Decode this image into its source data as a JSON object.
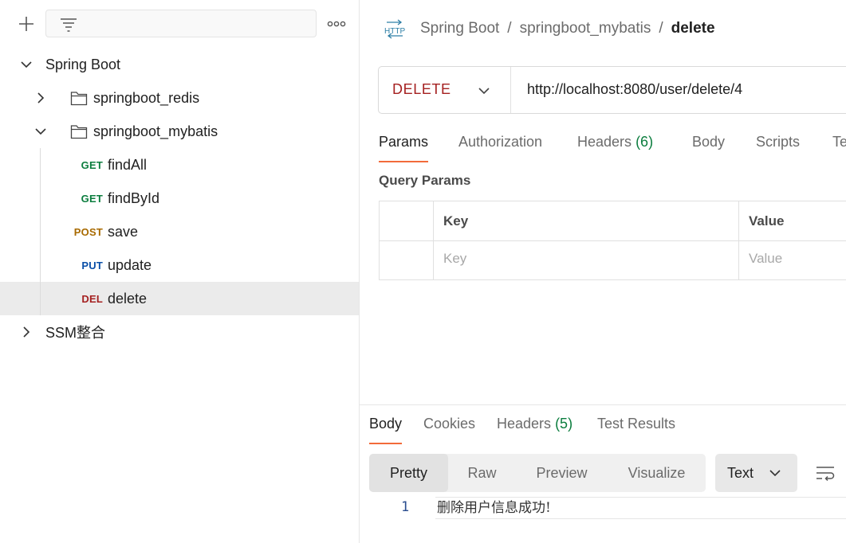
{
  "sidebar": {
    "new_icon": "plus-icon",
    "filter_icon": "filter-lines-icon",
    "more_icon": "more-horizontal-icon",
    "tree": {
      "collection": "Spring Boot",
      "folder_redis": "springboot_redis",
      "folder_mybatis": "springboot_mybatis",
      "requests": [
        {
          "method": "GET",
          "name": "findAll"
        },
        {
          "method": "GET",
          "name": "findById"
        },
        {
          "method": "POST",
          "name": "save"
        },
        {
          "method": "PUT",
          "name": "update"
        },
        {
          "method": "DEL",
          "name": "delete"
        }
      ],
      "collection2": "SSM整合"
    }
  },
  "main": {
    "http_icon_label": "HTTP",
    "breadcrumb": {
      "part1": "Spring Boot",
      "sep": "/",
      "part2": "springboot_mybatis",
      "current": "delete"
    },
    "request": {
      "method": "DELETE",
      "url": "http://localhost:8080/user/delete/4"
    },
    "tabs": {
      "params": "Params",
      "authorization": "Authorization",
      "headers": "Headers",
      "headers_count": "(6)",
      "body": "Body",
      "scripts": "Scripts",
      "tests": "Te"
    },
    "query_params": {
      "title": "Query Params",
      "key_header": "Key",
      "value_header": "Value",
      "key_placeholder": "Key",
      "value_placeholder": "Value"
    },
    "response": {
      "tabs": {
        "body": "Body",
        "cookies": "Cookies",
        "headers": "Headers",
        "headers_count": "(5)",
        "test_results": "Test Results"
      },
      "views": {
        "pretty": "Pretty",
        "raw": "Raw",
        "preview": "Preview",
        "visualize": "Visualize"
      },
      "format": "Text",
      "line_number": "1",
      "body_text": "删除用户信息成功!"
    }
  },
  "colors": {
    "get": "#0b7d3e",
    "post": "#a86a00",
    "put": "#0a4fa8",
    "delete": "#a52121",
    "accent": "#f26b3a"
  }
}
